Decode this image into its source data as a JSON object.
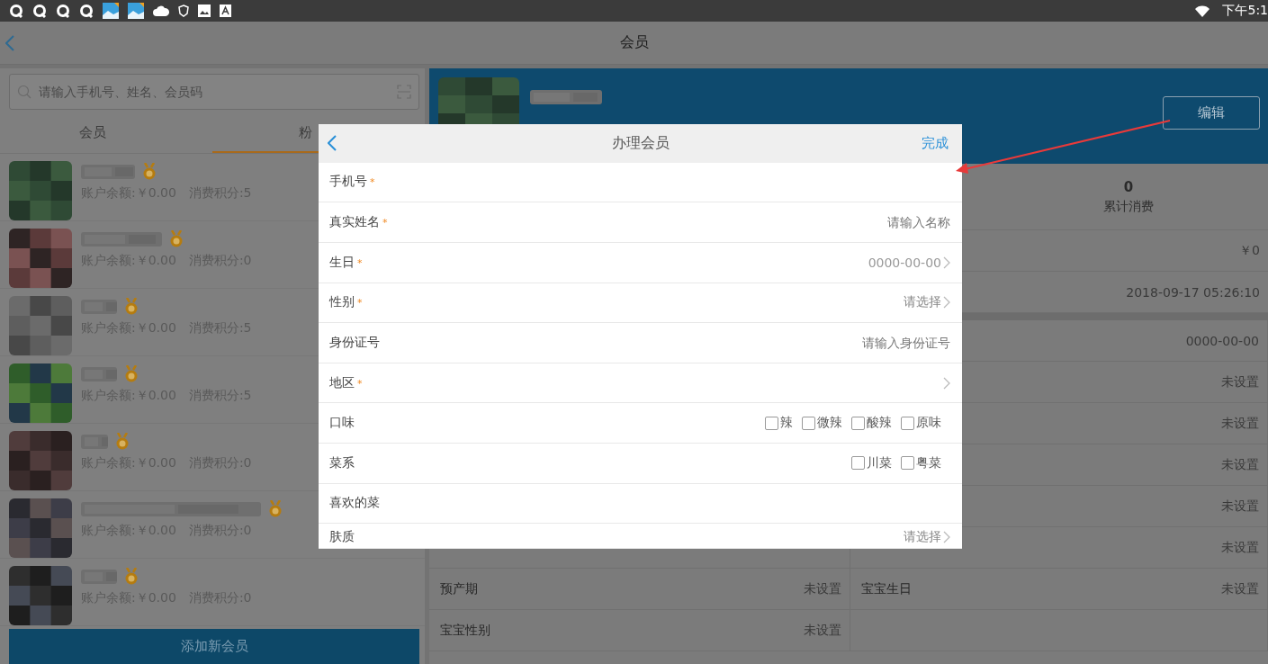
{
  "status_bar": {
    "time": "下午5:1"
  },
  "nav": {
    "title": "会员"
  },
  "search": {
    "placeholder": "请输入手机号、姓名、会员码"
  },
  "tabs": [
    {
      "label": "会员",
      "selected": false
    },
    {
      "label": "粉",
      "selected": true
    }
  ],
  "members": [
    {
      "balance": "账户余额:￥0.00",
      "points": "消费积分:5"
    },
    {
      "balance": "账户余额:￥0.00",
      "points": "消费积分:0"
    },
    {
      "balance": "账户余额:￥0.00",
      "points": "消费积分:5"
    },
    {
      "balance": "账户余额:￥0.00",
      "points": "消费积分:5"
    },
    {
      "balance": "账户余额:￥0.00",
      "points": "消费积分:0"
    },
    {
      "balance": "账户余额:￥0.00",
      "points": "消费积分:0"
    },
    {
      "balance": "账户余额:￥0.00",
      "points": "消费积分:0"
    }
  ],
  "add_button": "添加新会员",
  "profile": {
    "edit_button": "编辑",
    "stats": [
      {
        "value": "0",
        "label": "累计消费"
      }
    ],
    "rows": [
      {
        "value": "￥0"
      },
      {
        "value": "2018-09-17 05:26:10"
      }
    ],
    "detail_rows": [
      {
        "right_value": "0000-00-00"
      },
      {
        "right_value": "未设置"
      },
      {
        "right_value": "未设置"
      },
      {
        "right_value": "未设置"
      },
      {
        "right_value": "未设置"
      },
      {
        "right_value": "未设置"
      },
      {
        "left_label": "预产期",
        "left_value": "未设置",
        "right_label": "宝宝生日",
        "right_value": "未设置"
      },
      {
        "left_label": "宝宝性别",
        "left_value": "未设置"
      }
    ]
  },
  "dialog": {
    "title": "办理会员",
    "done": "完成",
    "fields": [
      {
        "label": "手机号",
        "required_mark": "*",
        "kind": "input"
      },
      {
        "label": "真实姓名",
        "required_mark": "*",
        "kind": "input",
        "placeholder": "请输入名称"
      },
      {
        "label": "生日",
        "required_mark": "*",
        "kind": "select",
        "value": "0000-00-00"
      },
      {
        "label": "性别",
        "required_mark": "*",
        "kind": "select",
        "placeholder": "请选择"
      },
      {
        "label": "身份证号",
        "kind": "input",
        "placeholder": "请输入身份证号"
      },
      {
        "label": "地区",
        "required_mark": "*",
        "kind": "select"
      },
      {
        "label": "口味",
        "kind": "checkboxes",
        "options": [
          {
            "label": "辣",
            "checked": false
          },
          {
            "label": "微辣",
            "checked": false
          },
          {
            "label": "酸辣",
            "checked": false
          },
          {
            "label": "原味",
            "checked": false
          }
        ]
      },
      {
        "label": "菜系",
        "kind": "checkboxes",
        "options": [
          {
            "label": "川菜",
            "checked": false
          },
          {
            "label": "粤菜",
            "checked": false
          }
        ]
      },
      {
        "label": "喜欢的菜",
        "kind": "input"
      },
      {
        "label": "肤质",
        "kind": "select",
        "placeholder": "请选择"
      }
    ]
  }
}
